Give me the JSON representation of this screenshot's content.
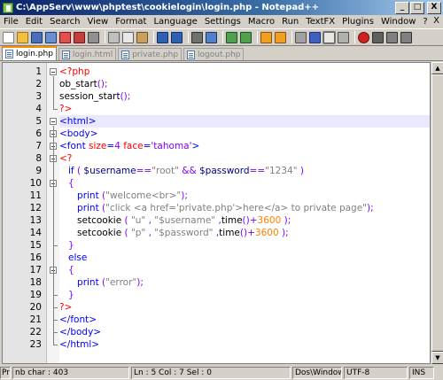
{
  "window": {
    "title": "C:\\AppServ\\www\\phptest\\cookielogin\\login.php - Notepad++",
    "minimize": "_",
    "maximize": "□",
    "close": "X"
  },
  "menu": [
    "File",
    "Edit",
    "Search",
    "View",
    "Format",
    "Language",
    "Settings",
    "Macro",
    "Run",
    "TextFX",
    "Plugins",
    "Window",
    "?"
  ],
  "menu_close": "X",
  "tabs": [
    {
      "label": "login.php",
      "active": true
    },
    {
      "label": "login.html",
      "active": false
    },
    {
      "label": "private.php",
      "active": false
    },
    {
      "label": "logout.php",
      "active": false
    }
  ],
  "editor": {
    "current_line": 5,
    "lines": [
      {
        "n": "1",
        "segments": [
          {
            "t": "<?php",
            "c": "php"
          }
        ]
      },
      {
        "n": "2",
        "segments": [
          {
            "t": "ob_start",
            "c": "fn"
          },
          {
            "t": "();",
            "c": "op"
          }
        ]
      },
      {
        "n": "3",
        "segments": [
          {
            "t": "session_start",
            "c": "fn"
          },
          {
            "t": "();",
            "c": "op"
          }
        ]
      },
      {
        "n": "4",
        "segments": [
          {
            "t": "?>",
            "c": "php"
          }
        ]
      },
      {
        "n": "5",
        "segments": [
          {
            "t": "<html>",
            "c": "html"
          }
        ]
      },
      {
        "n": "6",
        "segments": [
          {
            "t": "<body>",
            "c": "html"
          }
        ]
      },
      {
        "n": "7",
        "segments": [
          {
            "t": "<font ",
            "c": "html"
          },
          {
            "t": "size",
            "c": "attr"
          },
          {
            "t": "=",
            "c": "html"
          },
          {
            "t": "4 ",
            "c": "val"
          },
          {
            "t": "face",
            "c": "attr"
          },
          {
            "t": "=",
            "c": "html"
          },
          {
            "t": "'tahoma'",
            "c": "val"
          },
          {
            "t": ">",
            "c": "html"
          }
        ]
      },
      {
        "n": "8",
        "segments": [
          {
            "t": "<?",
            "c": "php"
          }
        ]
      },
      {
        "n": "9",
        "segments": [
          {
            "t": "   ",
            "c": "fn"
          },
          {
            "t": "if",
            "c": "kw"
          },
          {
            "t": " ( ",
            "c": "op"
          },
          {
            "t": "$username",
            "c": "var"
          },
          {
            "t": "==",
            "c": "op"
          },
          {
            "t": "\"root\"",
            "c": "str"
          },
          {
            "t": " && ",
            "c": "op"
          },
          {
            "t": "$password",
            "c": "var"
          },
          {
            "t": "==",
            "c": "op"
          },
          {
            "t": "\"1234\"",
            "c": "str"
          },
          {
            "t": " )",
            "c": "op"
          }
        ]
      },
      {
        "n": "10",
        "segments": [
          {
            "t": "   {",
            "c": "op"
          }
        ]
      },
      {
        "n": "11",
        "segments": [
          {
            "t": "      ",
            "c": "fn"
          },
          {
            "t": "print",
            "c": "kw"
          },
          {
            "t": " (",
            "c": "op"
          },
          {
            "t": "\"welcome<br>\"",
            "c": "str"
          },
          {
            "t": ");",
            "c": "op"
          }
        ]
      },
      {
        "n": "12",
        "segments": [
          {
            "t": "      ",
            "c": "fn"
          },
          {
            "t": "print",
            "c": "kw"
          },
          {
            "t": " (",
            "c": "op"
          },
          {
            "t": "\"click <a href='private.php'>here</a> to private page\"",
            "c": "str"
          },
          {
            "t": ");",
            "c": "op"
          }
        ]
      },
      {
        "n": "13",
        "segments": [
          {
            "t": "      setcookie",
            "c": "fn"
          },
          {
            "t": " ( ",
            "c": "op"
          },
          {
            "t": "\"u\"",
            "c": "str"
          },
          {
            "t": " , ",
            "c": "op"
          },
          {
            "t": "\"$username\"",
            "c": "str"
          },
          {
            "t": " ,",
            "c": "op"
          },
          {
            "t": "time",
            "c": "fn"
          },
          {
            "t": "()+",
            "c": "op"
          },
          {
            "t": "3600",
            "c": "num"
          },
          {
            "t": " );",
            "c": "op"
          }
        ]
      },
      {
        "n": "14",
        "segments": [
          {
            "t": "      setcookie",
            "c": "fn"
          },
          {
            "t": " ( ",
            "c": "op"
          },
          {
            "t": "\"p\"",
            "c": "str"
          },
          {
            "t": " , ",
            "c": "op"
          },
          {
            "t": "\"$password\"",
            "c": "str"
          },
          {
            "t": " ,",
            "c": "op"
          },
          {
            "t": "time",
            "c": "fn"
          },
          {
            "t": "()+",
            "c": "op"
          },
          {
            "t": "3600",
            "c": "num"
          },
          {
            "t": " );",
            "c": "op"
          }
        ]
      },
      {
        "n": "15",
        "segments": [
          {
            "t": "   }",
            "c": "op"
          }
        ]
      },
      {
        "n": "16",
        "segments": [
          {
            "t": "   ",
            "c": "fn"
          },
          {
            "t": "else",
            "c": "kw"
          }
        ]
      },
      {
        "n": "17",
        "segments": [
          {
            "t": "   {",
            "c": "op"
          }
        ]
      },
      {
        "n": "18",
        "segments": [
          {
            "t": "      ",
            "c": "fn"
          },
          {
            "t": "print",
            "c": "kw"
          },
          {
            "t": " (",
            "c": "op"
          },
          {
            "t": "\"error\"",
            "c": "str"
          },
          {
            "t": ");",
            "c": "op"
          }
        ]
      },
      {
        "n": "19",
        "segments": [
          {
            "t": "   }",
            "c": "op"
          }
        ]
      },
      {
        "n": "20",
        "segments": [
          {
            "t": "?>",
            "c": "php"
          }
        ]
      },
      {
        "n": "21",
        "segments": [
          {
            "t": "</font>",
            "c": "html"
          }
        ]
      },
      {
        "n": "22",
        "segments": [
          {
            "t": "</body>",
            "c": "html"
          }
        ]
      },
      {
        "n": "23",
        "segments": [
          {
            "t": "</html>",
            "c": "html"
          }
        ]
      }
    ]
  },
  "status": {
    "type": "Pr",
    "length": "nb char : 403",
    "position": "Ln : 5   Col : 7   Sel : 0",
    "eol": "Dos\\Windows",
    "encoding": "UTF-8",
    "mode": "INS"
  },
  "colors": {
    "titlebar_start": "#0a246a",
    "titlebar_end": "#a6caf0",
    "active_tab_accent": "#fa8c00",
    "current_line": "#e8e8ff"
  }
}
